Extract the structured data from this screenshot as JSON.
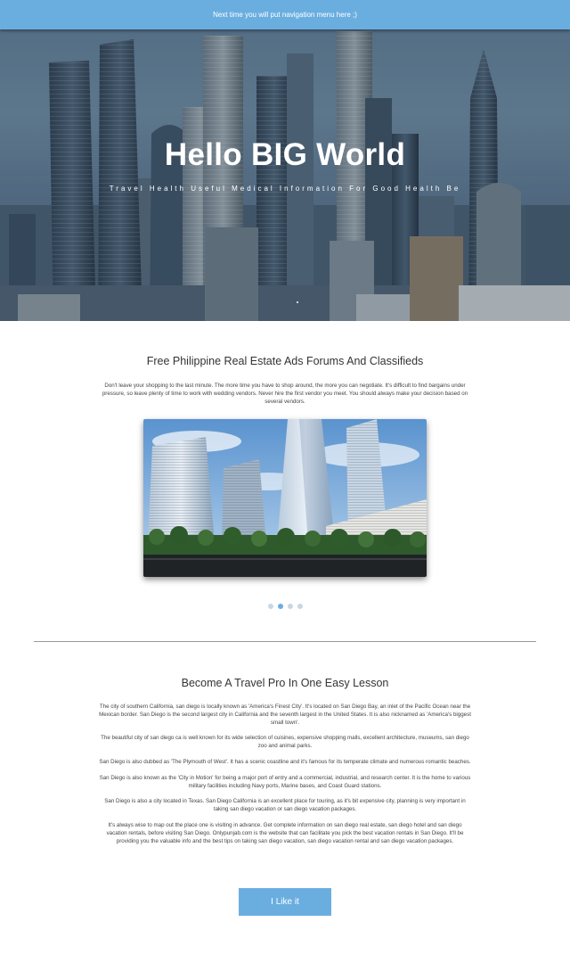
{
  "topbar": {
    "text": "Next time you will put navigation menu here ;)"
  },
  "hero": {
    "title": "Hello BIG World",
    "subtitle": "Travel Health Useful Medical Information For Good Health Be"
  },
  "section1": {
    "title": "Free Philippine Real Estate Ads Forums And Classifieds",
    "paragraph": "Don't leave your shopping to the last minute. The more time you have to shop around, the more you can negotiate. It's difficult to find bargains under pressure, so leave plenty of time to work with wedding vendors. Never hire the first vendor you meet. You should always make your decision based on several vendors."
  },
  "carousel": {
    "slides": 4,
    "active_index": 1
  },
  "section2": {
    "title": "Become A Travel Pro In One Easy Lesson",
    "paragraphs": [
      "The city of southern California, san diego is locally known as 'America's Finest City'. It's located on San Diego Bay, an inlet of the Pacific Ocean near the Mexican border. San Diego is the second largest city in California and the seventh largest in the United States. It is also nicknamed as 'America's biggest small town'.",
      "The beautiful city of san diego ca is well known for its wide selection of cuisines, expensive shopping malls, excellent architecture, museums, san diego zoo and animal parks.",
      "San Diego is also dubbed as 'The Plymouth of West'. It has a scenic coastline and it's famous for its temperate climate and numerous romantic beaches.",
      "San Diego is also known as the 'City in Motion' for being a major port of entry and a commercial, industrial, and research center. It is the home to various military facilities including Navy ports, Marine bases, and Coast Guard stations.",
      "San Diego is also a city located in Texas. San Diego California is an excellent place for touring, as it's bit expensive city, planning is very important in taking san diego vacation or san diego vacation packages.",
      "It's always wise to map out the place one is visiting in advance. Get complete information on san diego real estate, san diego hotel and san diego vacation rentals, before visiting San Diego. Onlypunjab.com is the website that can facilitate you pick the best vacation rentals in San Diego. It'll be providing you the valuable info and the best tips on taking san diego vacation, san diego vacation rental and san diego vacation packages."
    ]
  },
  "button": {
    "label": "I Like it"
  },
  "colors": {
    "accent": "#6aaee0",
    "divider": "#9a9a9a"
  }
}
